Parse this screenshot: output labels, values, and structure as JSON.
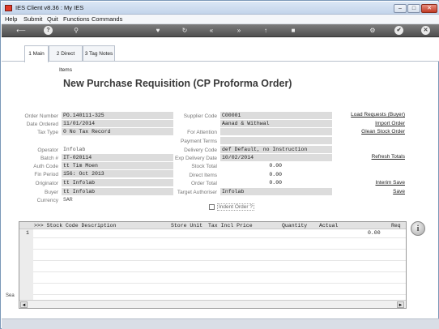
{
  "window": {
    "title": "IES Client v8.36 : My IES",
    "minimize": "–",
    "maximize": "□",
    "close": "✕"
  },
  "menu": [
    "Help",
    "Submit",
    "Quit",
    "Functions",
    "Commands"
  ],
  "toolbar": {
    "back": "⟵",
    "help": "?",
    "search": "⚲",
    "favorite": "♥",
    "refresh": "↻",
    "rewind": "«",
    "forward": "»",
    "up": "↑",
    "stop": "■",
    "settings": "⚙",
    "ok": "✔",
    "close": "✕"
  },
  "tabs": [
    {
      "label": "1 Main",
      "active": true
    },
    {
      "label": "2 Direct Items",
      "active": false
    },
    {
      "label": "3 Tag Notes",
      "active": false
    }
  ],
  "page_title": "New Purchase  Requisition (CP Proforma Order)",
  "left_fields": {
    "order_number": {
      "label": "Order Number",
      "value": "PO.140111-325"
    },
    "date_ordered": {
      "label": "Date Ordered",
      "value": "11/01/2014"
    },
    "tax_type": {
      "label": "Tax Type",
      "value": "0 No Tax Record"
    },
    "operator": {
      "label": "Operator",
      "value": "Infolab"
    },
    "batch": {
      "label": "Batch #",
      "value": "IT-020114"
    },
    "auth_code": {
      "label": "Auth Code",
      "value": "tt Tim Moen"
    },
    "fin_period": {
      "label": "Fin Period",
      "value": "156: Oct 2013"
    },
    "originator": {
      "label": "Originator",
      "value": "tt Infolab"
    },
    "buyer": {
      "label": "Buyer",
      "value": "tt Infolab"
    },
    "currency": {
      "label": "Currency",
      "value": "SAR"
    }
  },
  "right_fields": {
    "supplier_code": {
      "label": "Supplier Code",
      "value": "C00001"
    },
    "supplier_name": {
      "value": "Aanad & Withwal"
    },
    "for_attention": {
      "label": "For Attention",
      "value": ""
    },
    "payment_terms": {
      "label": "Payment Terms",
      "value": ""
    },
    "delivery_code": {
      "label": "Delivery Code",
      "value": "def Default, no Instruction"
    },
    "exp_delivery_date": {
      "label": "Exp Delivery Date",
      "value": "10/02/2014"
    },
    "stock_total": {
      "label": "Stock Total",
      "value": "0.00"
    },
    "direct_items": {
      "label": "Direct Items",
      "value": "0.00"
    },
    "order_total": {
      "label": "Order Total",
      "value": "0.00"
    },
    "target_authoriser": {
      "label": "Target Authoriser",
      "value": "Infolab"
    }
  },
  "indent_order": {
    "label": "Indent Order ?",
    "checked": false
  },
  "links": {
    "load_requests": "Load Requests (Buyer)",
    "import_order": "Import Order",
    "glean_stock": "Glean Stock Order",
    "refresh_totals": "Refresh Totals",
    "interim_save": "Interim Save",
    "save": "Save"
  },
  "grid": {
    "columns": [
      ">>> Stock Code Description",
      "Store Unit",
      "Tax Incl Price",
      "Quantity",
      "Actual",
      "Req"
    ],
    "rows": [
      {
        "num": "1",
        "value": "0.00"
      }
    ],
    "scroll_left": "◄",
    "scroll_right": "►"
  },
  "info_icon": "i",
  "side_cut_text": "Sea"
}
